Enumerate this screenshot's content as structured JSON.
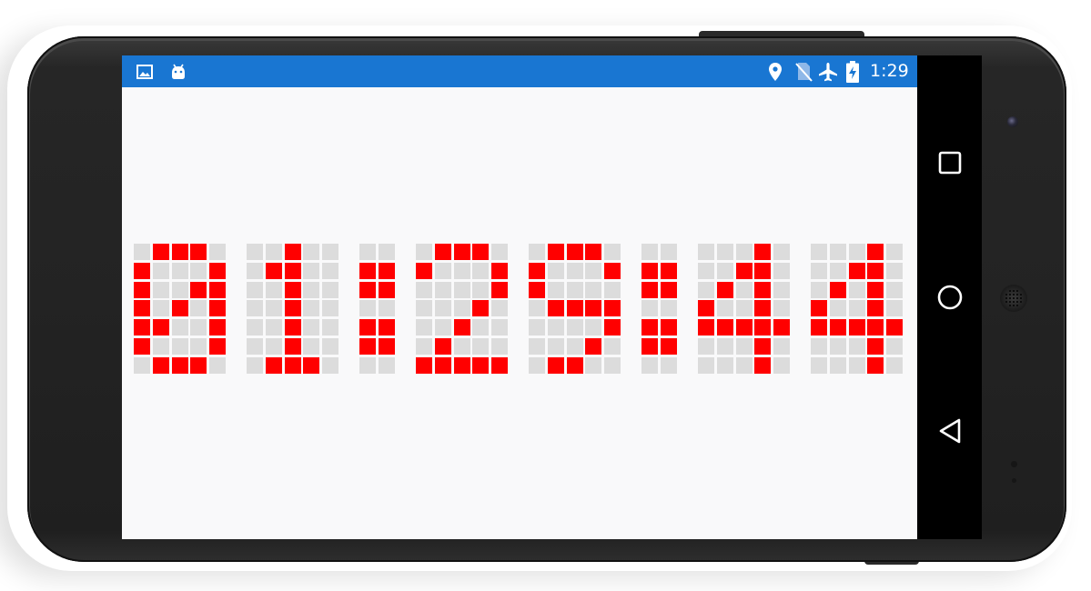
{
  "status_bar": {
    "time": "1:29",
    "left_icons": [
      "image-icon",
      "android-icon"
    ],
    "right_icons": [
      "location-pin-icon",
      "no-sim-icon",
      "airplane-mode-icon",
      "battery-charging-icon"
    ],
    "background_color": "#1976d2"
  },
  "navigation_bar": {
    "buttons": [
      "recent-apps",
      "home",
      "back"
    ]
  },
  "led_display": {
    "on_color": "#ff0000",
    "off_color": "#dcdcdc",
    "text": "01:23:44",
    "glyphs": [
      {
        "char": "0",
        "rows": [
          "01110",
          "10001",
          "10011",
          "10101",
          "11001",
          "10001",
          "01110"
        ]
      },
      {
        "char": "1",
        "rows": [
          "00100",
          "01100",
          "00100",
          "00100",
          "00100",
          "00100",
          "01110"
        ]
      },
      {
        "char": ":",
        "rows": [
          "00",
          "11",
          "11",
          "00",
          "11",
          "11",
          "00"
        ]
      },
      {
        "char": "2",
        "rows": [
          "01110",
          "10001",
          "00001",
          "00010",
          "00100",
          "01000",
          "11111"
        ]
      },
      {
        "char": "3",
        "rows": [
          "01110",
          "10001",
          "10000",
          "01111",
          "00001",
          "00010",
          "01100"
        ]
      },
      {
        "char": ":",
        "rows": [
          "00",
          "11",
          "11",
          "00",
          "11",
          "11",
          "00"
        ]
      },
      {
        "char": "4",
        "rows": [
          "00010",
          "00110",
          "01010",
          "10010",
          "11111",
          "00010",
          "00010"
        ]
      },
      {
        "char": "4",
        "rows": [
          "00010",
          "00110",
          "01010",
          "10010",
          "11111",
          "00010",
          "00010"
        ]
      }
    ]
  }
}
